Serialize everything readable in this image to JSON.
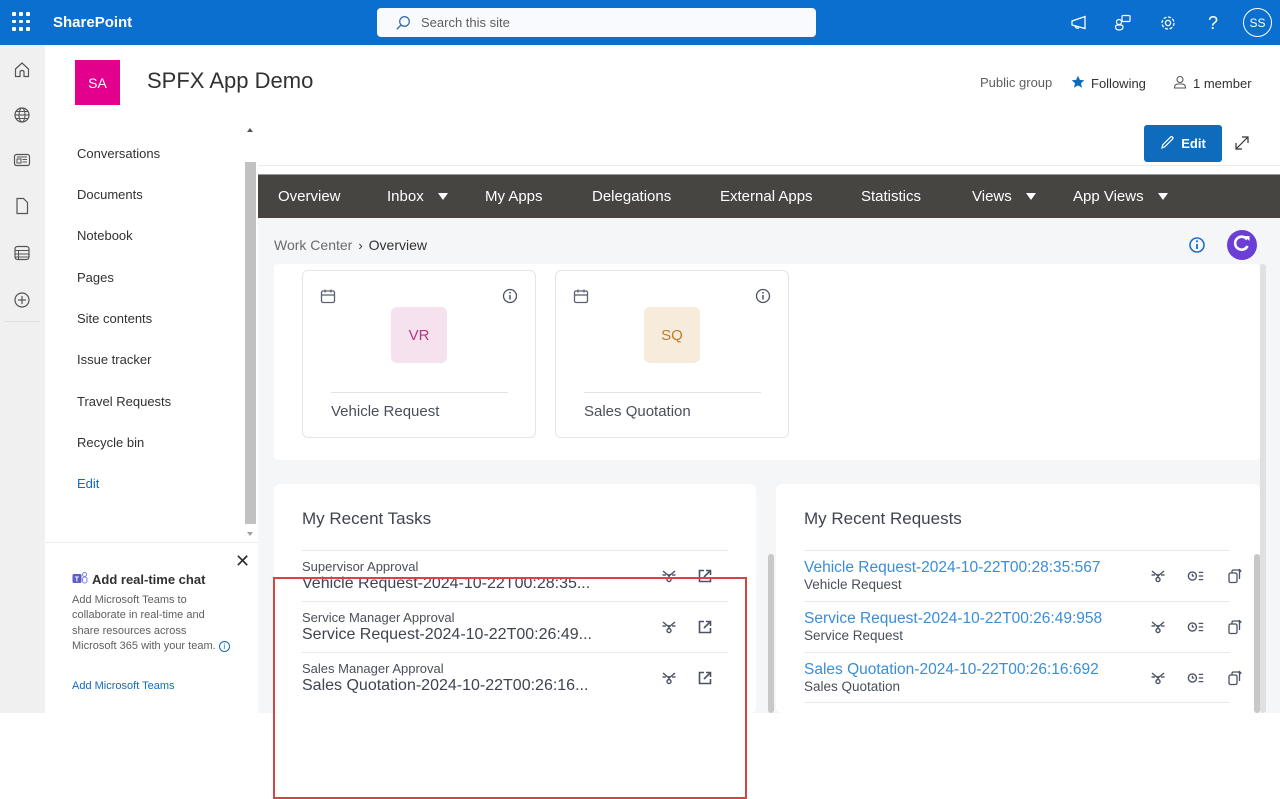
{
  "suitebar": {
    "brand": "SharePoint",
    "search_placeholder": "Search this site",
    "avatar_initials": "SS",
    "icons": [
      "waffle-icon",
      "megaphone-icon",
      "teams-chat-icon",
      "gear-icon",
      "help-icon"
    ]
  },
  "appbar": {
    "icons": [
      "home-icon",
      "globe-icon",
      "news-icon",
      "document-icon",
      "list-icon",
      "add-icon"
    ]
  },
  "site": {
    "logo_initials": "SA",
    "title": "SPFX App Demo",
    "group_type": "Public group",
    "following_label": "Following",
    "members_label": "1 member",
    "logo_color": "#e3008c"
  },
  "leftnav": {
    "items": [
      {
        "label": "Conversations"
      },
      {
        "label": "Documents"
      },
      {
        "label": "Notebook"
      },
      {
        "label": "Pages"
      },
      {
        "label": "Site contents"
      },
      {
        "label": "Issue tracker"
      },
      {
        "label": "Travel Requests"
      },
      {
        "label": "Recycle bin"
      }
    ],
    "edit_label": "Edit"
  },
  "teams_promo": {
    "title": "Add real-time chat",
    "description": "Add Microsoft Teams to collaborate in real-time and share resources across Microsoft 365 with your team.",
    "link_label": "Add Microsoft Teams"
  },
  "command_bar": {
    "edit_label": "Edit"
  },
  "nav": {
    "tabs": [
      {
        "label": "Overview",
        "dropdown": false
      },
      {
        "label": "Inbox",
        "dropdown": true
      },
      {
        "label": "My Apps",
        "dropdown": false
      },
      {
        "label": "Delegations",
        "dropdown": false
      },
      {
        "label": "External Apps",
        "dropdown": false
      },
      {
        "label": "Statistics",
        "dropdown": false
      },
      {
        "label": "Views",
        "dropdown": true
      },
      {
        "label": "App Views",
        "dropdown": true
      }
    ]
  },
  "breadcrumb": {
    "root": "Work Center",
    "separator": "›",
    "current": "Overview"
  },
  "apps": [
    {
      "initials": "VR",
      "name": "Vehicle Request",
      "bg": "#f6e1ef",
      "fg": "#b03a7e"
    },
    {
      "initials": "SQ",
      "name": "Sales Quotation",
      "bg": "#f7ecdc",
      "fg": "#c07a2a"
    }
  ],
  "recent_tasks": {
    "title": "My Recent Tasks",
    "items": [
      {
        "step": "Supervisor Approval",
        "title": "Vehicle Request-2024-10-22T00:28:35..."
      },
      {
        "step": "Service Manager Approval",
        "title": "Service Request-2024-10-22T00:26:49..."
      },
      {
        "step": "Sales Manager Approval",
        "title": "Sales Quotation-2024-10-22T00:26:16..."
      }
    ]
  },
  "recent_requests": {
    "title": "My Recent Requests",
    "items": [
      {
        "title": "Vehicle Request-2024-10-22T00:28:35:567",
        "app": "Vehicle Request"
      },
      {
        "title": "Service Request-2024-10-22T00:26:49:958",
        "app": "Service Request"
      },
      {
        "title": "Sales Quotation-2024-10-22T00:26:16:692",
        "app": "Sales Quotation"
      }
    ]
  },
  "colors": {
    "suitebar": "#0b6fcf",
    "nav_bg": "#474542",
    "accent": "#0f6cbd",
    "refresh": "#6b3fd6",
    "highlight": "#d64545",
    "link": "#3a8dd8"
  }
}
